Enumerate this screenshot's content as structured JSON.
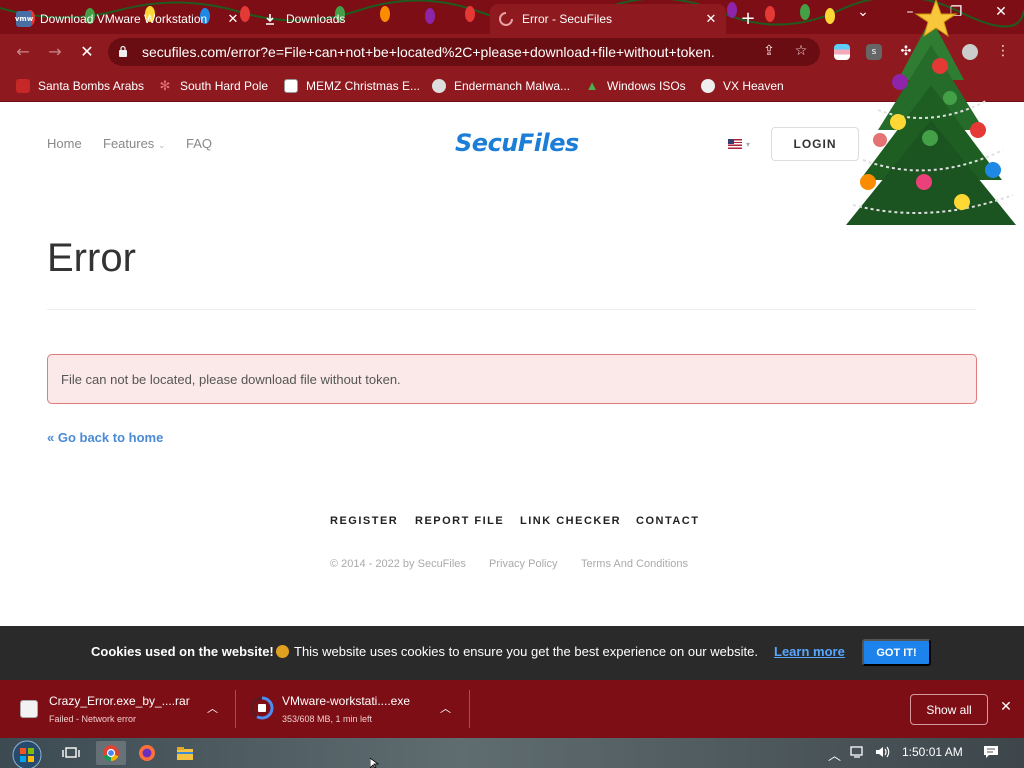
{
  "browser": {
    "tabs": [
      {
        "title": "Download VMware Workstation",
        "icon": "vmware-icon",
        "close": "✕"
      },
      {
        "title": "Downloads",
        "icon": "download-icon",
        "close": ""
      },
      {
        "title": "Error - SecuFiles",
        "icon": "loading-spinner-icon",
        "close": "✕",
        "active": true
      }
    ],
    "new_tab": "+",
    "window_controls": {
      "minimize": "–",
      "restore": "❐",
      "close": "✕"
    },
    "url": "secufiles.com/error?e=File+can+not+be+located%2C+please+download+file+without+token.",
    "bookmarks": [
      {
        "label": "Santa Bombs Arabs",
        "icon": "santa-icon"
      },
      {
        "label": "South Hard Pole",
        "icon": "snowflake-icon"
      },
      {
        "label": "MEMZ Christmas E...",
        "icon": "memz-icon"
      },
      {
        "label": "Endermanch Malwa...",
        "icon": "skull-icon"
      },
      {
        "label": "Windows ISOs",
        "icon": "tree-icon"
      },
      {
        "label": "VX Heaven",
        "icon": "virus-icon"
      }
    ]
  },
  "site": {
    "nav": {
      "home": "Home",
      "features": "Features",
      "features_caret": "⌄",
      "faq": "FAQ"
    },
    "brand": "SecuFiles",
    "login": "LOGIN",
    "error_title": "Error",
    "alert_message": "File can not be located, please download file without token.",
    "back_link": "« Go back to home",
    "footer": {
      "links": [
        "REGISTER",
        "REPORT FILE",
        "LINK CHECKER",
        "CONTACT"
      ],
      "copyright": "© 2014 - 2022 by SecuFiles",
      "privacy": "Privacy Policy",
      "terms": "Terms And Conditions"
    }
  },
  "cookie_banner": {
    "title": "Cookies used on the website!",
    "text": "This website uses cookies to ensure you get the best experience on our website.",
    "learn_more": "Learn more",
    "button": "GOT IT!"
  },
  "downloads": {
    "items": [
      {
        "name": "Crazy_Error.exe_by_....rar",
        "status": "Failed - Network error",
        "icon": "winrar-icon"
      },
      {
        "name": "VMware-workstati....exe",
        "status": "353/608 MB, 1 min left",
        "icon": "vmware-installer-icon",
        "progress": 0.58
      }
    ],
    "show_all": "Show all",
    "close": "✕"
  },
  "taskbar": {
    "time": "1:50:01 AM"
  },
  "colors": {
    "chrome_red": "#7e0e15",
    "brand_blue": "#1c7ed6",
    "alert_bg": "#fbe9e9",
    "alert_border": "#e17b7b",
    "link_blue": "#4a8ad6",
    "cookie_btn": "#1c83ec"
  }
}
